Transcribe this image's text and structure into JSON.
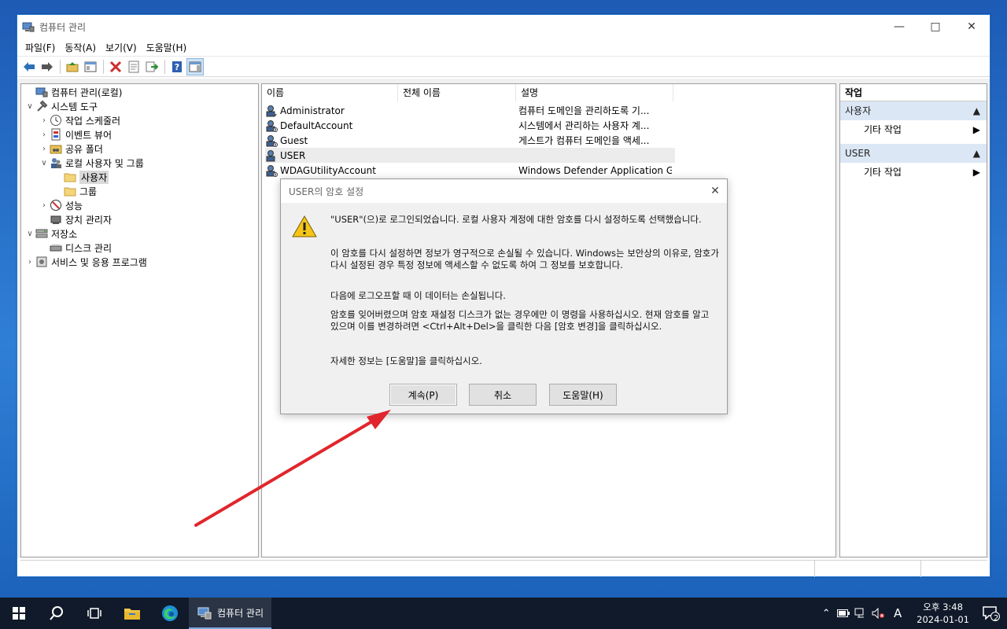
{
  "window": {
    "title": "컴퓨터 관리",
    "menu": [
      "파일(F)",
      "동작(A)",
      "보기(V)",
      "도움말(H)"
    ]
  },
  "tree": {
    "root": "컴퓨터 관리(로컬)",
    "system_tools": "시스템 도구",
    "task_scheduler": "작업 스케줄러",
    "event_viewer": "이벤트 뷰어",
    "shared_folders": "공유 폴더",
    "local_users_groups": "로컬 사용자 및 그룹",
    "users": "사용자",
    "groups": "그룹",
    "performance": "성능",
    "device_manager": "장치 관리자",
    "storage": "저장소",
    "disk_management": "디스크 관리",
    "services_apps": "서비스 및 응용 프로그램"
  },
  "list": {
    "columns": [
      "이름",
      "전체 이름",
      "설명"
    ],
    "rows": [
      {
        "name": "Administrator",
        "full_name": "",
        "description": "컴퓨터 도메인을 관리하도록 기..."
      },
      {
        "name": "DefaultAccount",
        "full_name": "",
        "description": "시스템에서 관리하는 사용자 계..."
      },
      {
        "name": "Guest",
        "full_name": "",
        "description": "게스트가 컴퓨터 도메인을 액세..."
      },
      {
        "name": "USER",
        "full_name": "",
        "description": ""
      },
      {
        "name": "WDAGUtilityAccount",
        "full_name": "",
        "description": "Windows Defender Application G..."
      }
    ]
  },
  "actions": {
    "header": "작업",
    "section1": "사용자",
    "section1_item": "기타 작업",
    "section2": "USER",
    "section2_item": "기타 작업"
  },
  "dialog": {
    "title": "USER의 암호 설정",
    "para1": "\"USER\"(으)로 로그인되었습니다. 로컬 사용자 계정에 대한 암호를 다시 설정하도록 선택했습니다.",
    "para2": "이 암호를 다시 설정하면 정보가 영구적으로 손실될 수 있습니다. Windows는 보안상의 이유로, 암호가 다시 설정된 경우 특정 정보에 액세스할 수 없도록 하여 그 정보를 보호합니다.",
    "para3": "다음에 로그오프할 때 이 데이터는 손실됩니다.",
    "para4": "암호를 잊어버렸으며 암호 재설정 디스크가 없는 경우에만 이 명령을 사용하십시오. 현재 암호를 알고 있으며 이를 변경하려면 <Ctrl+Alt+Del>을 클릭한 다음 [암호 변경]을 클릭하십시오.",
    "para5": "자세한 정보는 [도움말]을 클릭하십시오.",
    "btn_continue": "계속(P)",
    "btn_cancel": "취소",
    "btn_help": "도움말(H)"
  },
  "taskbar": {
    "app_label": "컴퓨터 관리",
    "ime": "A",
    "time": "오후 3:48",
    "date": "2024-01-01",
    "notif_count": "2"
  },
  "colors": {
    "arrow": "#e0262c",
    "selection": "#d9d9d9",
    "action_section": "#dbe7f5"
  }
}
